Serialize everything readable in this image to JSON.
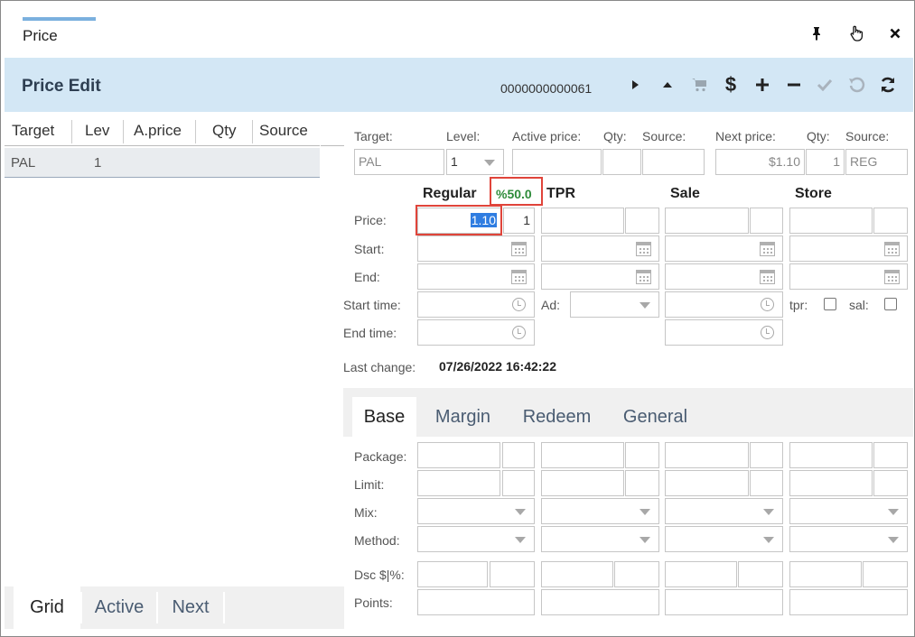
{
  "window": {
    "title": "Price",
    "pin_icon": "pin-icon",
    "pointer_icon": "hand-pointer-icon",
    "close_icon": "close-icon"
  },
  "header": {
    "title": "Price Edit",
    "code": "0000000000061",
    "toolbar": [
      "play-icon",
      "triangle-up-icon",
      "cart-icon",
      "dollar-icon",
      "plus-icon",
      "minus-icon",
      "check-icon",
      "undo-icon",
      "refresh-icon"
    ]
  },
  "grid": {
    "columns": [
      "Target",
      "Lev",
      "A.price",
      "Qty",
      "Source"
    ],
    "rows": [
      {
        "target": "PAL",
        "lev": "1",
        "aprice": "",
        "qty": "",
        "source": ""
      }
    ]
  },
  "left_tabs": [
    "Grid",
    "Active",
    "Next"
  ],
  "info": {
    "target_label": "Target:",
    "level_label": "Level:",
    "active_price_label": "Active price:",
    "qty_label": "Qty:",
    "source_label": "Source:",
    "next_price_label": "Next price:",
    "next_qty_label": "Qty:",
    "next_source_label": "Source:",
    "target_value": "PAL",
    "level_value": "1",
    "active_price_value": "",
    "active_qty_value": "",
    "active_source_value": "",
    "next_price_value": "$1.10",
    "next_qty_value": "1",
    "next_source_value": "REG"
  },
  "columns": {
    "regular": "Regular",
    "margin_pct": "%50.0",
    "tpr": "TPR",
    "sale": "Sale",
    "store": "Store"
  },
  "rows": {
    "price": "Price:",
    "start": "Start:",
    "end": "End:",
    "start_time": "Start time:",
    "end_time": "End time:",
    "ad": "Ad:",
    "tpr": "tpr:",
    "sal": "sal:"
  },
  "regular_price": {
    "value": "1.10",
    "qty": "1"
  },
  "last_change": {
    "label": "Last change:",
    "value": "07/26/2022 16:42:22"
  },
  "bottom_tabs": [
    "Base",
    "Margin",
    "Redeem",
    "General"
  ],
  "base": {
    "package": "Package:",
    "limit": "Limit:",
    "mix": "Mix:",
    "method": "Method:",
    "dsc": "Dsc $|%:",
    "points": "Points:"
  },
  "colors": {
    "header_bg": "#d3e7f5",
    "accent": "#7bb0de",
    "highlight": "#e0443a",
    "margin_text": "#2e8b3a"
  }
}
